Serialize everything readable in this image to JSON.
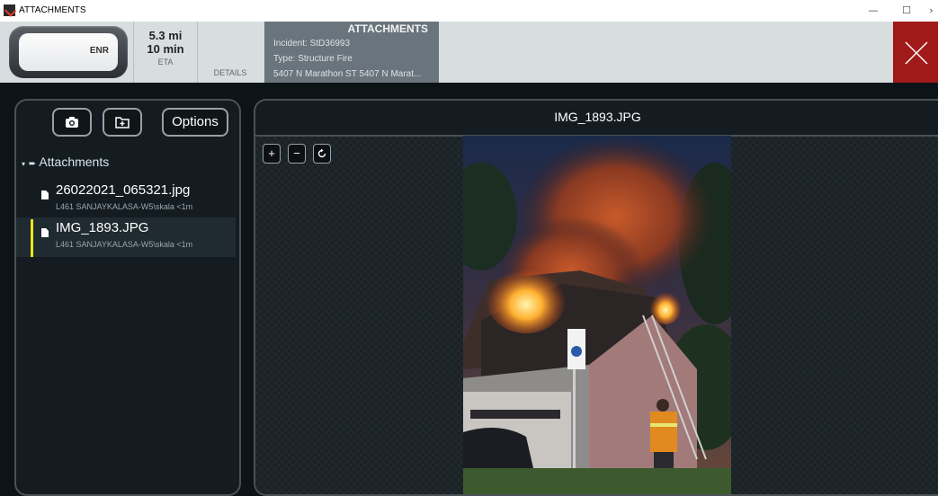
{
  "window": {
    "title": "ATTACHMENTS",
    "controls": {
      "minimize": "—",
      "maximize": "☐",
      "close": "›"
    }
  },
  "header": {
    "unit_status": "ENR",
    "distance": "5.3 mi",
    "eta_value": "10 min",
    "eta_label": "ETA",
    "details_label": "DETAILS",
    "incident_title": "ATTACHMENTS",
    "incident_line": "Incident: StD36993",
    "type_line": "Type:  Structure Fire",
    "address_line": "5407 N Marathon ST 5407 N Marat...",
    "close_color": "#a01a1a"
  },
  "left_panel": {
    "camera_icon": "camera-icon",
    "add_folder_icon": "add-attachment-icon",
    "options_label": "Options",
    "tree_root": "Attachments",
    "items": [
      {
        "name": "26022021_065321.jpg",
        "meta": "L461  SANJAYKALASA-W5\\skala  <1m",
        "selected": false
      },
      {
        "name": "IMG_1893.JPG",
        "meta": "L461  SANJAYKALASA-W5\\skala  <1m",
        "selected": true
      }
    ],
    "selection_color": "#e6e61a"
  },
  "viewer": {
    "filename": "IMG_1893.JPG",
    "zoom_in": "+",
    "zoom_out": "−",
    "rotate_icon": "rotate-icon"
  }
}
